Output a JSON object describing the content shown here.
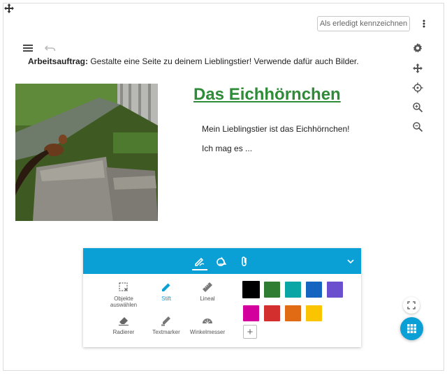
{
  "toolbar_top": {
    "done_label": "Als erledigt kennzeichnen"
  },
  "task": {
    "label": "Arbeitsauftrag:",
    "text": " Gestalte eine Seite zu deinem Lieblingstier! Verwende dafür auch Bilder."
  },
  "content": {
    "title": "Das Eichhörnchen",
    "para1": "Mein Lieblingstier ist das Eichhörnchen!",
    "para2": "Ich mag es ..."
  },
  "side_icons": [
    "gear-icon",
    "move-icon",
    "crosshair-icon",
    "zoom-in-icon",
    "zoom-out-icon"
  ],
  "drawing_toolbar": {
    "tabs": [
      "pen-tab",
      "shapes-tab",
      "attachment-tab"
    ],
    "tools": [
      {
        "label": "Objekte auswählen",
        "icon": "select-icon",
        "active": false
      },
      {
        "label": "Stift",
        "icon": "pen-icon",
        "active": true
      },
      {
        "label": "Lineal",
        "icon": "ruler-icon",
        "active": false
      },
      {
        "label": "Radierer",
        "icon": "eraser-icon",
        "active": false
      },
      {
        "label": "Textmarker",
        "icon": "marker-icon",
        "active": false
      },
      {
        "label": "Winkelmesser",
        "icon": "protractor-icon",
        "active": false
      }
    ],
    "colors": [
      "#000000",
      "#2e7d32",
      "#0aa6a6",
      "#1565c0",
      "#6a4fcf",
      "#d3009e",
      "#d32f2f",
      "#e06b14",
      "#fbc400"
    ],
    "selected_color": "#000000",
    "add_color_label": "+"
  }
}
